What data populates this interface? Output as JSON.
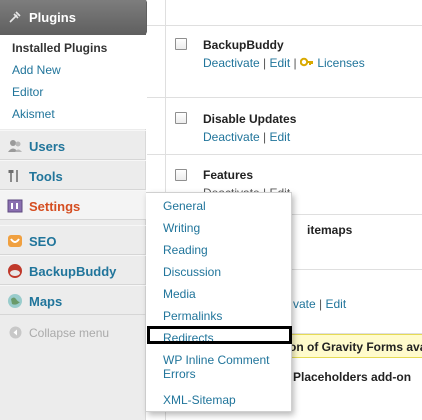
{
  "sidebar": {
    "plugins_header": "Plugins",
    "plugins_submenu": [
      "Installed Plugins",
      "Add New",
      "Editor",
      "Akismet"
    ],
    "nav": [
      {
        "label": "Users",
        "icon": "users-icon"
      },
      {
        "label": "Tools",
        "icon": "tools-icon"
      },
      {
        "label": "Settings",
        "icon": "settings-icon"
      },
      {
        "label": "SEO",
        "icon": "seo-icon"
      },
      {
        "label": "BackupBuddy",
        "icon": "backupbuddy-icon"
      },
      {
        "label": "Maps",
        "icon": "maps-icon"
      }
    ],
    "collapse_label": "Collapse menu"
  },
  "flyout": {
    "items": [
      "General",
      "Writing",
      "Reading",
      "Discussion",
      "Media",
      "Permalinks",
      "Redirects",
      "WP Inline Comment Errors",
      "XML-Sitemap"
    ],
    "wp_inline_line1": "WP Inline Comment",
    "wp_inline_line2": "Errors"
  },
  "plugins": [
    {
      "name": "BackupBuddy",
      "deactivate": "Deactivate",
      "edit": "Edit",
      "licenses": "Licenses"
    },
    {
      "name": "Disable Updates",
      "deactivate": "Deactivate",
      "edit": "Edit"
    },
    {
      "name": "Features",
      "actions_visible": "Deactivate | Edit"
    },
    {
      "name_partial": "itemaps"
    },
    {
      "actions_partial_deactivate": "vate",
      "edit": "Edit"
    },
    {
      "notice_partial": "on of Gravity Forms ava"
    },
    {
      "name_partial": "Placeholders add-on"
    }
  ],
  "colors": {
    "link": "#21759b",
    "active": "#d54e21",
    "notice_bg": "#fffbcc"
  }
}
